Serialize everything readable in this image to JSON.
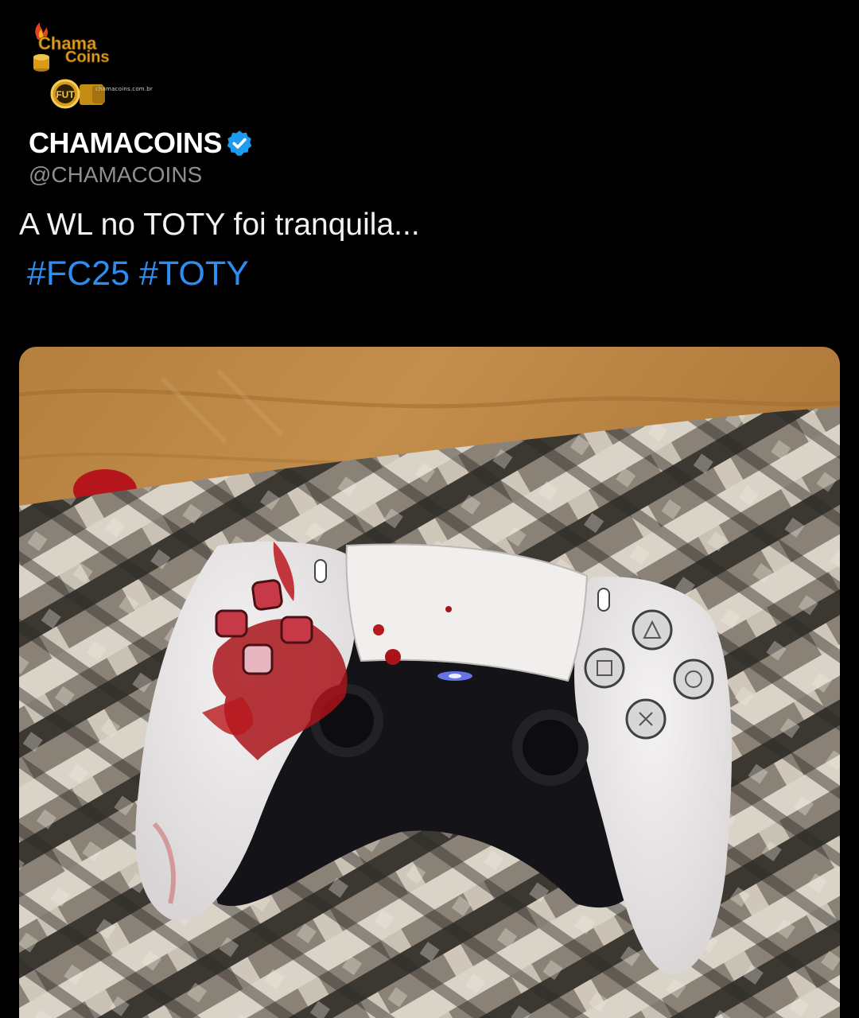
{
  "brand": {
    "logo_line1": "Chama",
    "logo_line2": "Coins",
    "logo_site": "chamacoins.com.br",
    "badge_text": "FUT",
    "accent_gold": "#e0a21b"
  },
  "tweet": {
    "display_name": "CHAMACOINS",
    "handle": "@CHAMACOINS",
    "verified_icon": "verified-badge-icon",
    "text": "A WL no TOTY foi tranquila...",
    "hashtags": [
      "#FC25",
      "#TOTY"
    ],
    "link_color": "#2c8ef3"
  },
  "media": {
    "description_icon": "ps5-controller-photo",
    "face_buttons": [
      "triangle",
      "square",
      "circle",
      "cross"
    ]
  }
}
